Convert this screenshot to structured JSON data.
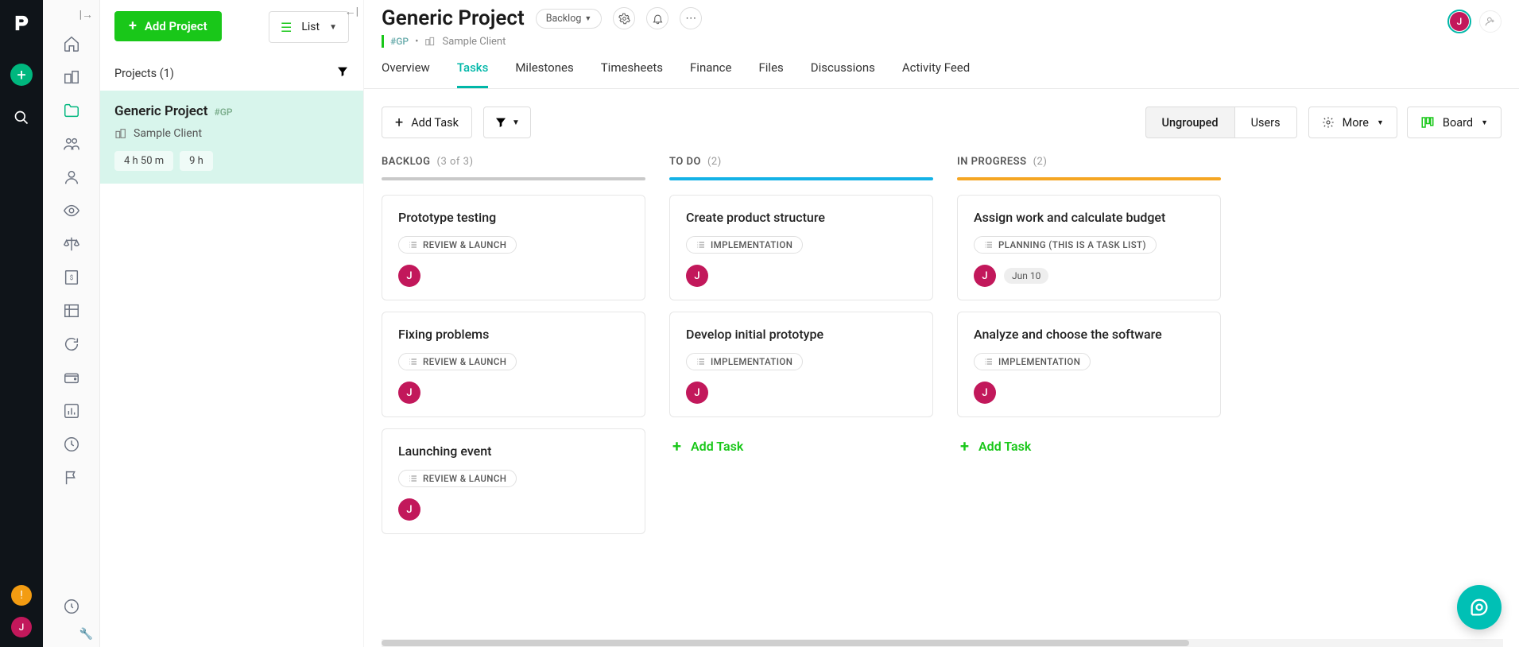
{
  "rail": {
    "avatar_initial": "J"
  },
  "panel": {
    "add_project": "Add Project",
    "list_label": "List",
    "projects_count": "Projects (1)",
    "item": {
      "name": "Generic Project",
      "code": "#GP",
      "client": "Sample Client",
      "time_spent": "4 h 50 m",
      "time_budget": "9 h"
    }
  },
  "header": {
    "title": "Generic Project",
    "stage_chip": "Backlog",
    "code": "#GP",
    "client": "Sample Client",
    "avatar_initial": "J"
  },
  "tabs": [
    "Overview",
    "Tasks",
    "Milestones",
    "Timesheets",
    "Finance",
    "Files",
    "Discussions",
    "Activity Feed"
  ],
  "active_tab": "Tasks",
  "toolbar": {
    "add_task": "Add Task",
    "seg_ungrouped": "Ungrouped",
    "seg_users": "Users",
    "more": "More",
    "board": "Board"
  },
  "lanes": {
    "backlog": {
      "title": "BACKLOG",
      "count": "(3 of 3)"
    },
    "todo": {
      "title": "TO DO",
      "count": "(2)"
    },
    "progress": {
      "title": "IN PROGRESS",
      "count": "(2)"
    }
  },
  "cards": {
    "b1": {
      "title": "Prototype testing",
      "tag": "REVIEW & LAUNCH",
      "assignee": "J"
    },
    "b2": {
      "title": "Fixing problems",
      "tag": "REVIEW & LAUNCH",
      "assignee": "J"
    },
    "b3": {
      "title": "Launching event",
      "tag": "REVIEW & LAUNCH",
      "assignee": "J"
    },
    "t1": {
      "title": "Create product structure",
      "tag": "IMPLEMENTATION",
      "assignee": "J"
    },
    "t2": {
      "title": "Develop initial prototype",
      "tag": "IMPLEMENTATION",
      "assignee": "J"
    },
    "p1": {
      "title": "Assign work and calculate budget",
      "tag": "PLANNING (THIS IS A TASK LIST)",
      "assignee": "J",
      "date": "Jun 10"
    },
    "p2": {
      "title": "Analyze and choose the software",
      "tag": "IMPLEMENTATION",
      "assignee": "J"
    }
  },
  "add_task_label": "Add Task"
}
